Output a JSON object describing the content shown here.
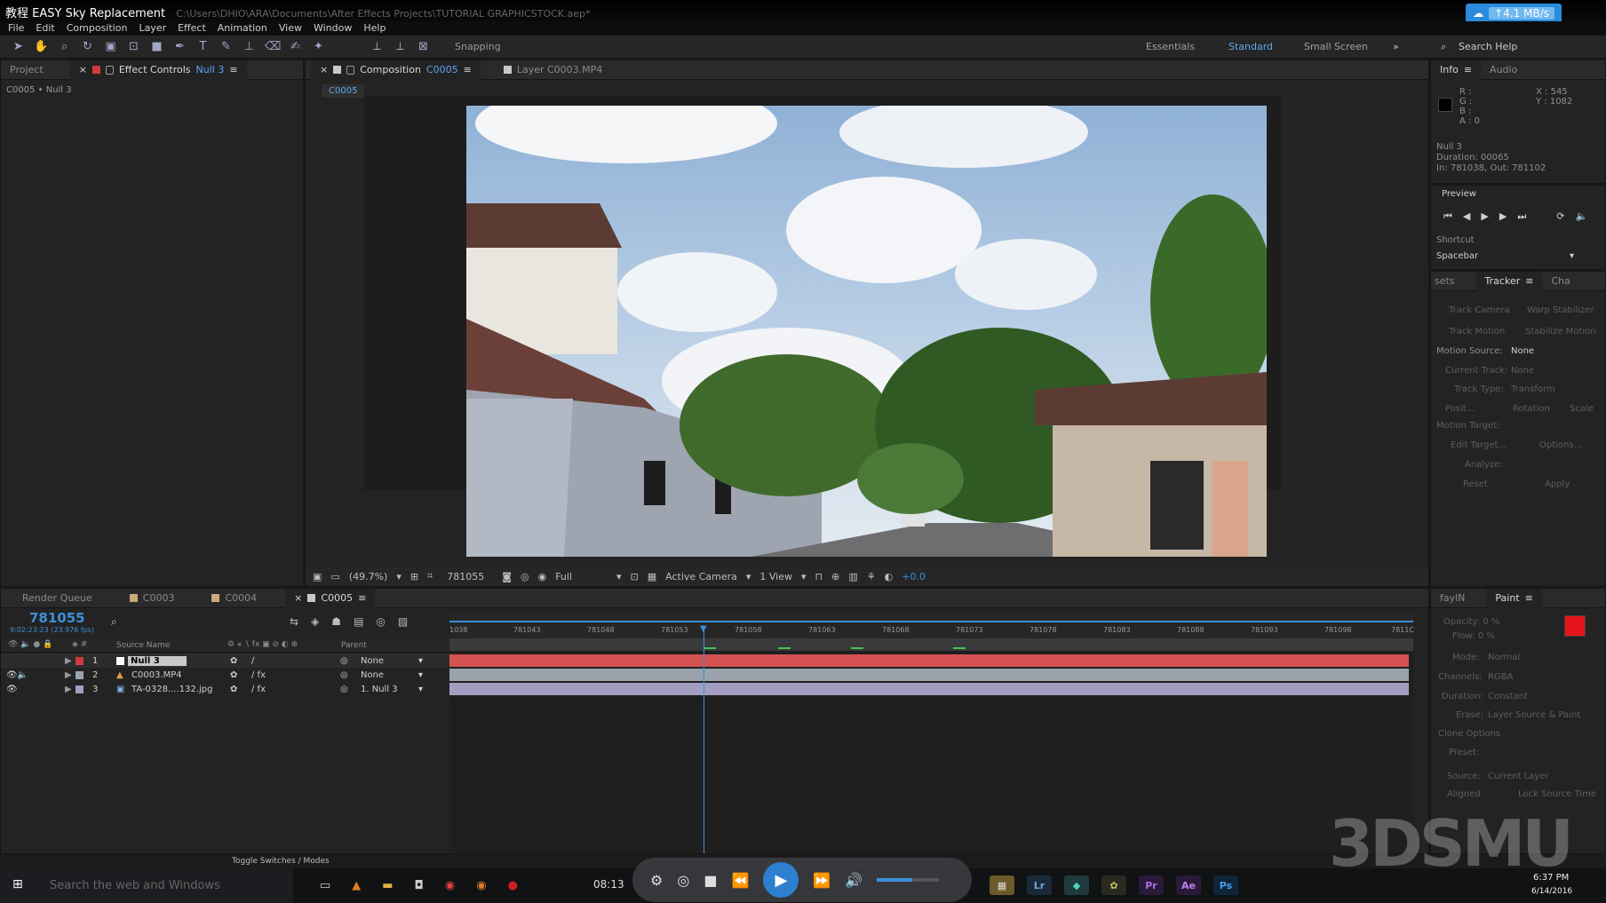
{
  "app": {
    "title": "教程 EASY Sky Replacement",
    "path": "C:\\Users\\DHIO\\ARA\\Documents\\After Effects Projects\\TUTORIAL GRAPHICSTOCK.aep*",
    "net_speed": "↑4.1 MB/s"
  },
  "menu": [
    "File",
    "Edit",
    "Composition",
    "Layer",
    "Effect",
    "Animation",
    "View",
    "Window",
    "Help"
  ],
  "toolbar": {
    "snapping": "Snapping",
    "workspaces": [
      "Essentials",
      "Standard",
      "Small Screen"
    ],
    "search": "Search Help"
  },
  "left_panel": {
    "tab_project": "Project",
    "tab_effect_controls": "Effect Controls",
    "effect_layer": "Null 3",
    "subtitle": "C0005 • Null 3"
  },
  "viewer": {
    "tab_composition": "Composition",
    "comp_name": "C0005",
    "tab_layer": "Layer C0003.MP4",
    "comp_chip": "C0005",
    "zoom": "(49.7%)",
    "timecode": "781055",
    "resolution": "Full",
    "camera": "Active Camera",
    "views": "1 View",
    "exposure": "+0.0"
  },
  "info": {
    "tab_info": "Info",
    "tab_audio": "Audio",
    "r": "R :",
    "g": "G :",
    "b": "B :",
    "a": "A : 0",
    "x": "X : 545",
    "y": "Y : 1082",
    "layer": "Null 3",
    "duration": "Duration: 00065",
    "inout": "In: 781038, Out: 781102"
  },
  "preview": {
    "title": "Preview",
    "shortcut_label": "Shortcut",
    "shortcut_value": "Spacebar"
  },
  "tracker": {
    "tab_sets": "sets",
    "tab_tracker": "Tracker",
    "tab_cha": "Cha",
    "track_camera": "Track Camera",
    "warp_stabilizer": "Warp Stabilizer",
    "track_motion": "Track Motion",
    "stabilize_motion": "Stabilize Motion",
    "motion_source_label": "Motion Source:",
    "motion_source_value": "None",
    "current_track_label": "Current Track:",
    "current_track_value": "None",
    "track_type_label": "Track Type:",
    "track_type_value": "Transform",
    "position": "Posit...",
    "rotation": "Rotation",
    "scale": "Scale",
    "motion_target": "Motion Target:",
    "edit_target": "Edit Target...",
    "options": "Options...",
    "analyze": "Analyze:",
    "reset": "Reset",
    "apply": "Apply"
  },
  "paint": {
    "tab_faylin": "faylN",
    "tab_paint": "Paint",
    "opacity": "Opacity: 0 %",
    "flow": "Flow: 0 %",
    "mode_label": "Mode:",
    "mode_value": "Normal",
    "channels_label": "Channels:",
    "channels_value": "RGBA",
    "duration_label": "Duration:",
    "duration_value": "Constant",
    "erase_label": "Erase:",
    "erase_value": "Layer Source & Paint",
    "clone_options": "Clone Options",
    "preset_label": "Preset:",
    "source_label": "Source:",
    "source_value": "Current Layer",
    "aligned": "Aligned",
    "lock_source_time": "Lock Source Time",
    "brush_color": "#e8141b"
  },
  "timeline": {
    "tab_render": "Render Queue",
    "tab_c0003": "C0003",
    "tab_c0004": "C0004",
    "tab_c0005": "C0005",
    "timecode": "781055",
    "timecode_sub": "9:02:23:23 (23.976 fps)",
    "col_source": "Source Name",
    "col_parent": "Parent",
    "toggle": "Toggle Switches / Modes",
    "ruler": [
      "1038",
      "781043",
      "781048",
      "781053",
      "781058",
      "781063",
      "781068",
      "781073",
      "781078",
      "781083",
      "781088",
      "781093",
      "781098",
      "7811C"
    ],
    "layers": [
      {
        "num": "1",
        "name": "Null 3",
        "parent": "None",
        "color": "#e04c4c",
        "label": "#d13a3a"
      },
      {
        "num": "2",
        "name": "C0003.MP4",
        "parent": "None",
        "color": "#b4bcc4",
        "label": "#9aa3ab"
      },
      {
        "num": "3",
        "name": "TA-0328....132.jpg",
        "parent": "1. Null 3",
        "color": "#a8a1bd",
        "label": "#a39ec0"
      }
    ]
  },
  "taskbar": {
    "search": "Search the web and Windows",
    "player_time": "08:13",
    "clock_time": "6:37 PM",
    "clock_date": "6/14/2016",
    "apps": [
      "Lr",
      "Pr",
      "Ae",
      "Ps"
    ]
  },
  "watermark": "3DSMU"
}
